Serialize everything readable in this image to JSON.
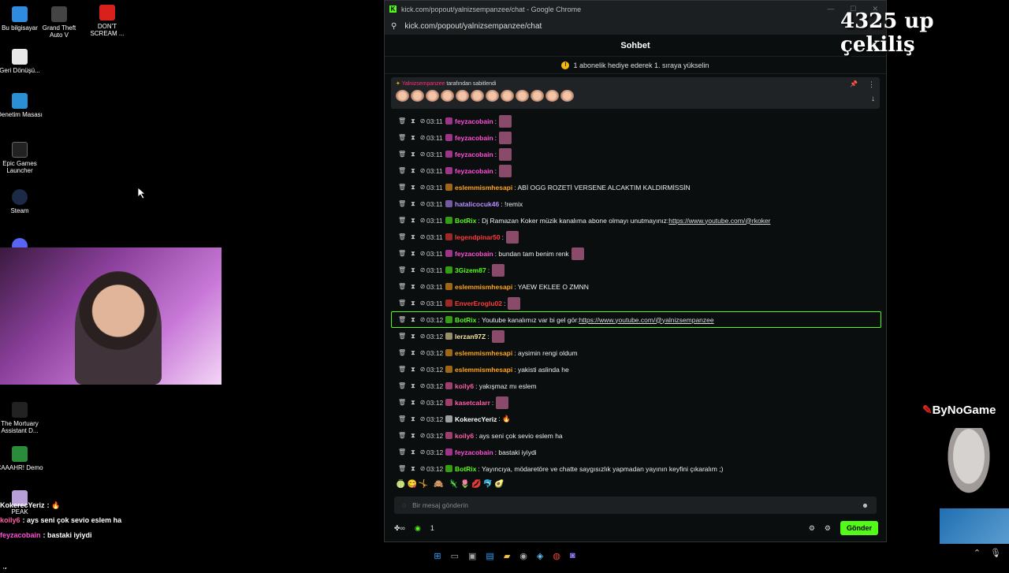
{
  "desktop": {
    "icons": [
      {
        "label": "Bu bilgisayar",
        "color": "#2f8be0"
      },
      {
        "label": "Grand Theft Auto V",
        "color": "#333"
      },
      {
        "label": "DON'T SCREAM ...",
        "color": "#d8211c"
      },
      {
        "label": "Geri Dönüşü...",
        "color": "#e8e8e8"
      },
      {
        "label": "Denetim Masası",
        "color": "#2a8fd4"
      },
      {
        "label": "Epic Games Launcher",
        "color": "#222"
      },
      {
        "label": "Steam",
        "color": "#1b2a45"
      },
      {
        "label": "The Mortuary Assistant D...",
        "color": "#222"
      },
      {
        "label": "CAAAHR! Demo",
        "color": "#2a8b3a"
      },
      {
        "label": "PEAK",
        "color": "#b7a0d8"
      }
    ]
  },
  "browser": {
    "title": "kick.com/popout/yalnizsempanzee/chat - Google Chrome",
    "url": "kick.com/popout/yalnizsempanzee/chat"
  },
  "chat": {
    "header": "Sohbet",
    "gift_banner": "1 abonelik hediye ederek 1. sıraya yükselin",
    "pinned": {
      "user": "Yalnizsempanzee",
      "by_text": "tarafından sabitlendi"
    },
    "messages": [
      {
        "time": "03:11",
        "user": "feyzacobain",
        "color": "#ff4fd8",
        "text": ":",
        "emote": true
      },
      {
        "time": "03:11",
        "user": "feyzacobain",
        "color": "#ff4fd8",
        "text": ":",
        "emote": true
      },
      {
        "time": "03:11",
        "user": "feyzacobain",
        "color": "#ff4fd8",
        "text": ":",
        "emote": true
      },
      {
        "time": "03:11",
        "user": "feyzacobain",
        "color": "#ff4fd8",
        "text": ":",
        "emote": true
      },
      {
        "time": "03:11",
        "user": "eslemmismhesapi",
        "color": "#ffa41b",
        "text": ": ABİ OGG ROZETİ VERSENE ALCAKTIM KALDIRMİSSİN"
      },
      {
        "time": "03:11",
        "user": "hatalicocuk46",
        "color": "#b98cff",
        "text": ": !remix"
      },
      {
        "time": "03:11",
        "user": "BotRix",
        "color": "#53fc18",
        "text": ": Dj Ramazan Koker müzik kanalıma abone olmayı unutmayınız: ",
        "link": "https://www.youtube.com/@rkoker"
      },
      {
        "time": "03:11",
        "user": "legendpinar50",
        "color": "#ff3b3b",
        "text": ":",
        "emote": true
      },
      {
        "time": "03:11",
        "user": "feyzacobain",
        "color": "#ff4fd8",
        "text": ": bundan tam benim renk",
        "emote": true
      },
      {
        "time": "03:11",
        "user": "3Gizem87",
        "color": "#53fc18",
        "text": ":",
        "emote": true
      },
      {
        "time": "03:11",
        "user": "eslemmismhesapi",
        "color": "#ffa41b",
        "text": ": YAEW EKLEE O ZMNN"
      },
      {
        "time": "03:11",
        "user": "EnverEroglu02",
        "color": "#ff3b3b",
        "text": ":",
        "emote": true
      },
      {
        "time": "03:12",
        "user": "BotRix",
        "color": "#53fc18",
        "text": ": Youtube kanalımız var bi gel gör: ",
        "link": "https://www.youtube.com/@yalnizsempanzee",
        "highlight": true
      },
      {
        "time": "03:12",
        "user": "lerzan97Z",
        "color": "#f5e6a8",
        "text": ":",
        "emote": true
      },
      {
        "time": "03:12",
        "user": "eslemmismhesapi",
        "color": "#ffa41b",
        "text": ": aysimin rengi oldum"
      },
      {
        "time": "03:12",
        "user": "eslemmismhesapi",
        "color": "#ffa41b",
        "text": ": yakisti aslinda he"
      },
      {
        "time": "03:12",
        "user": "koily6",
        "color": "#ff5fa8",
        "text": ": yakışmaz mı eslem"
      },
      {
        "time": "03:12",
        "user": "kasetcalarr",
        "color": "#ff5fa8",
        "text": ":",
        "emote": true
      },
      {
        "time": "03:12",
        "user": "KokerecYeriz",
        "color": "#ffffff",
        "text": ": 🔥"
      },
      {
        "time": "03:12",
        "user": "koily6",
        "color": "#ff5fa8",
        "text": ": ays seni çok sevio eslem ha"
      },
      {
        "time": "03:12",
        "user": "feyzacobain",
        "color": "#ff4fd8",
        "text": ": bastaki iyiydi"
      },
      {
        "time": "03:12",
        "user": "BotRix",
        "color": "#53fc18",
        "text": ": Yayıncıya, mödaretöre ve chatte saygısızlık yapmadan yayının keyfini çıkaralım ;)"
      }
    ],
    "input_placeholder": "Bir mesaj gönderin",
    "footer_count": "1",
    "send_label": "Gönder"
  },
  "overlay": {
    "title": "4325 up çekiliş",
    "brand": "ByNoGame"
  },
  "ext_chat": [
    {
      "user": "KokerecYeriz",
      "color": "#ffffff",
      "text": ": 🔥"
    },
    {
      "user": "koily6",
      "color": "#ff5fa8",
      "text": ": ays seni çok sevio eslem ha"
    },
    {
      "user": "feyzacobain",
      "color": "#ff4fd8",
      "text": ": bastaki iyiydi"
    },
    {
      "user": "BotRix",
      "color": "#53fc18",
      "text": ": Yayıncıya, mödaretöre ve chatte saygısızlık yapmadan yayının keyfini çıkaralım"
    },
    {
      "user": "",
      "color": "#ffffff",
      "text": ";)"
    }
  ]
}
